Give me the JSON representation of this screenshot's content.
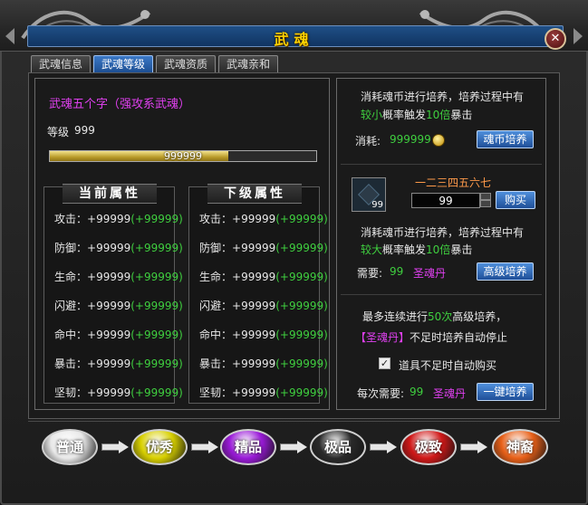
{
  "window": {
    "title": "武魂"
  },
  "tabs": [
    {
      "label": "武魂信息"
    },
    {
      "label": "武魂等级"
    },
    {
      "label": "武魂资质"
    },
    {
      "label": "武魂亲和"
    }
  ],
  "active_tab": 1,
  "soul": {
    "name": "武魂五个字（强攻系武魂）",
    "level_label": "等级",
    "level_value": "999",
    "exp_text": "999999",
    "exp_progress_fraction": 0.67
  },
  "current_attrs": {
    "title": "当前属性",
    "rows": [
      {
        "label": "攻击：",
        "value": "+99999",
        "bonus": "(+99999)"
      },
      {
        "label": "防御：",
        "value": "+99999",
        "bonus": "(+99999)"
      },
      {
        "label": "生命：",
        "value": "+99999",
        "bonus": "(+99999)"
      },
      {
        "label": "闪避：",
        "value": "+99999",
        "bonus": "(+99999)"
      },
      {
        "label": "命中：",
        "value": "+99999",
        "bonus": "(+99999)"
      },
      {
        "label": "暴击：",
        "value": "+99999",
        "bonus": "(+99999)"
      },
      {
        "label": "坚韧：",
        "value": "+99999",
        "bonus": "(+99999)"
      }
    ]
  },
  "next_attrs": {
    "title": "下级属性",
    "rows": [
      {
        "label": "攻击：",
        "value": "+99999",
        "bonus": "(+99999)"
      },
      {
        "label": "防御：",
        "value": "+99999",
        "bonus": "(+99999)"
      },
      {
        "label": "生命：",
        "value": "+99999",
        "bonus": "(+99999)"
      },
      {
        "label": "闪避：",
        "value": "+99999",
        "bonus": "(+99999)"
      },
      {
        "label": "命中：",
        "value": "+99999",
        "bonus": "(+99999)"
      },
      {
        "label": "暴击：",
        "value": "+99999",
        "bonus": "(+99999)"
      },
      {
        "label": "坚韧：",
        "value": "+99999",
        "bonus": "(+99999)"
      }
    ]
  },
  "coin_train": {
    "desc_line1": "消耗魂币进行培养，培养过程中有",
    "desc_line2_a": "较小",
    "desc_line2_b": "概率触发",
    "desc_line2_c": "10倍",
    "desc_line2_d": "暴击",
    "cost_label": "消耗:",
    "cost_value": "999999",
    "button": "魂币培养"
  },
  "item": {
    "name": "一二三四五六七",
    "slot_count": "99",
    "quantity": "99",
    "buy_button": "购买"
  },
  "advanced_train": {
    "desc_line1": "消耗魂币进行培养，培养过程中有",
    "desc_line2_a": "较大",
    "desc_line2_b": "概率触发",
    "desc_line2_c": "10倍",
    "desc_line2_d": "暴击",
    "need_label": "需要:",
    "need_value": "99",
    "need_item": "圣魂丹",
    "button": "高级培养"
  },
  "auto_train": {
    "line1_a": "最多连续进行",
    "line1_b": "50次",
    "line1_c": "高级培养，",
    "line2_a": "【圣魂丹】",
    "line2_b": "不足时培养自动停止",
    "checkbox_label": "道具不足时自动购买",
    "checkbox_checked": true,
    "each_label": "每次需要:",
    "each_value": "99",
    "each_item": "圣魂丹",
    "button": "一键培养"
  },
  "grades": [
    {
      "label": "普通",
      "color": "#e8e8e8"
    },
    {
      "label": "优秀",
      "color": "#d8d000"
    },
    {
      "label": "精品",
      "color": "#9a1ad8"
    },
    {
      "label": "极品",
      "color": "#2a2a2a"
    },
    {
      "label": "极致",
      "color": "#d01818"
    },
    {
      "label": "神裔",
      "color": "#e86018"
    }
  ],
  "colors": {
    "accent": "#1f4f98",
    "green": "#3fcf3f",
    "magenta": "#e040f0"
  }
}
